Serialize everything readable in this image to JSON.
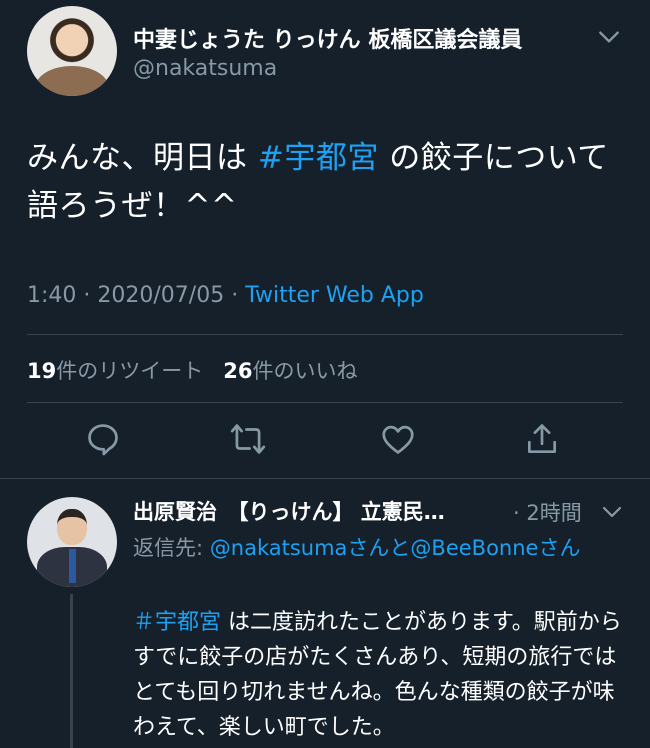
{
  "main_tweet": {
    "display_name": "中妻じょうた りっけん 板橋区議会議員",
    "handle": "@nakatsuma",
    "text_before": "みんな、明日は ",
    "hashtag": "#宇都宮",
    "text_after": " の餃子について語ろうぜ！^^",
    "time": "1:40",
    "separator": " · ",
    "date": "2020/07/05",
    "source": "Twitter Web App",
    "retweet_count": "19",
    "retweet_label": "件のリツイート",
    "like_count": "26",
    "like_label": "件のいいね"
  },
  "actions": {
    "reply_icon": "reply-icon",
    "retweet_icon": "retweet-icon",
    "like_icon": "heart-icon",
    "share_icon": "share-icon"
  },
  "reply_tweet": {
    "display_name": "出原賢治　【りっけん】 立憲民…",
    "time": "· 2時間",
    "replying_prefix": "返信先: ",
    "replying_user1": "@nakatsuma",
    "replying_mid": "さんと",
    "replying_user2": "@BeeBonne",
    "replying_suffix": "さん",
    "hashtag": "＃宇都宮",
    "text": " は二度訪れたことがあります。駅前からすでに餃子の店がたくさんあり、短期の旅行ではとても回り切れませんね。色んな種類の餃子が味わえて、楽しい町でした。"
  },
  "colors": {
    "background": "#15202b",
    "link": "#1da1f2",
    "muted": "#8899a6",
    "divider": "#38444d"
  }
}
